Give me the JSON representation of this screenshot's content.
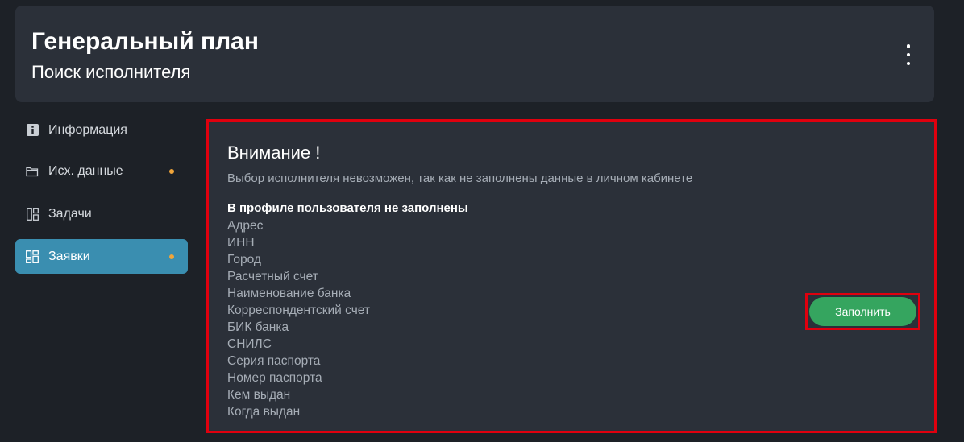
{
  "header": {
    "title": "Генеральный план",
    "subtitle": "Поиск исполнителя",
    "menu_icon": "more-vertical-icon"
  },
  "sidebar": {
    "items": [
      {
        "label": "Информация",
        "icon": "info-icon",
        "badge": false,
        "active": false
      },
      {
        "label": "Исх. данные",
        "icon": "folder-icon",
        "badge": true,
        "active": false
      },
      {
        "label": "Задачи",
        "icon": "layout-icon",
        "badge": false,
        "active": false
      },
      {
        "label": "Заявки",
        "icon": "dashboard-icon",
        "badge": true,
        "active": true
      }
    ]
  },
  "notice": {
    "heading": "Внимание !",
    "message": "Выбор исполнителя невозможен, так как не заполнены данные в личном кабинете",
    "list_title": "В профиле пользователя не заполнены",
    "missing_fields": [
      "Адрес",
      "ИНН",
      "Город",
      "Расчетный счет",
      "Наименование банка",
      "Корреспондентский счет",
      "БИК банка",
      "СНИЛС",
      "Серия паспорта",
      "Номер паспорта",
      "Кем выдан",
      "Когда выдан"
    ],
    "fill_button_label": "Заполнить"
  },
  "colors": {
    "background": "#1d2127",
    "panel": "#2b3039",
    "accent": "#3a8eb0",
    "badge": "#f0a53a",
    "button": "#35a55f",
    "highlight": "#e0000e"
  }
}
